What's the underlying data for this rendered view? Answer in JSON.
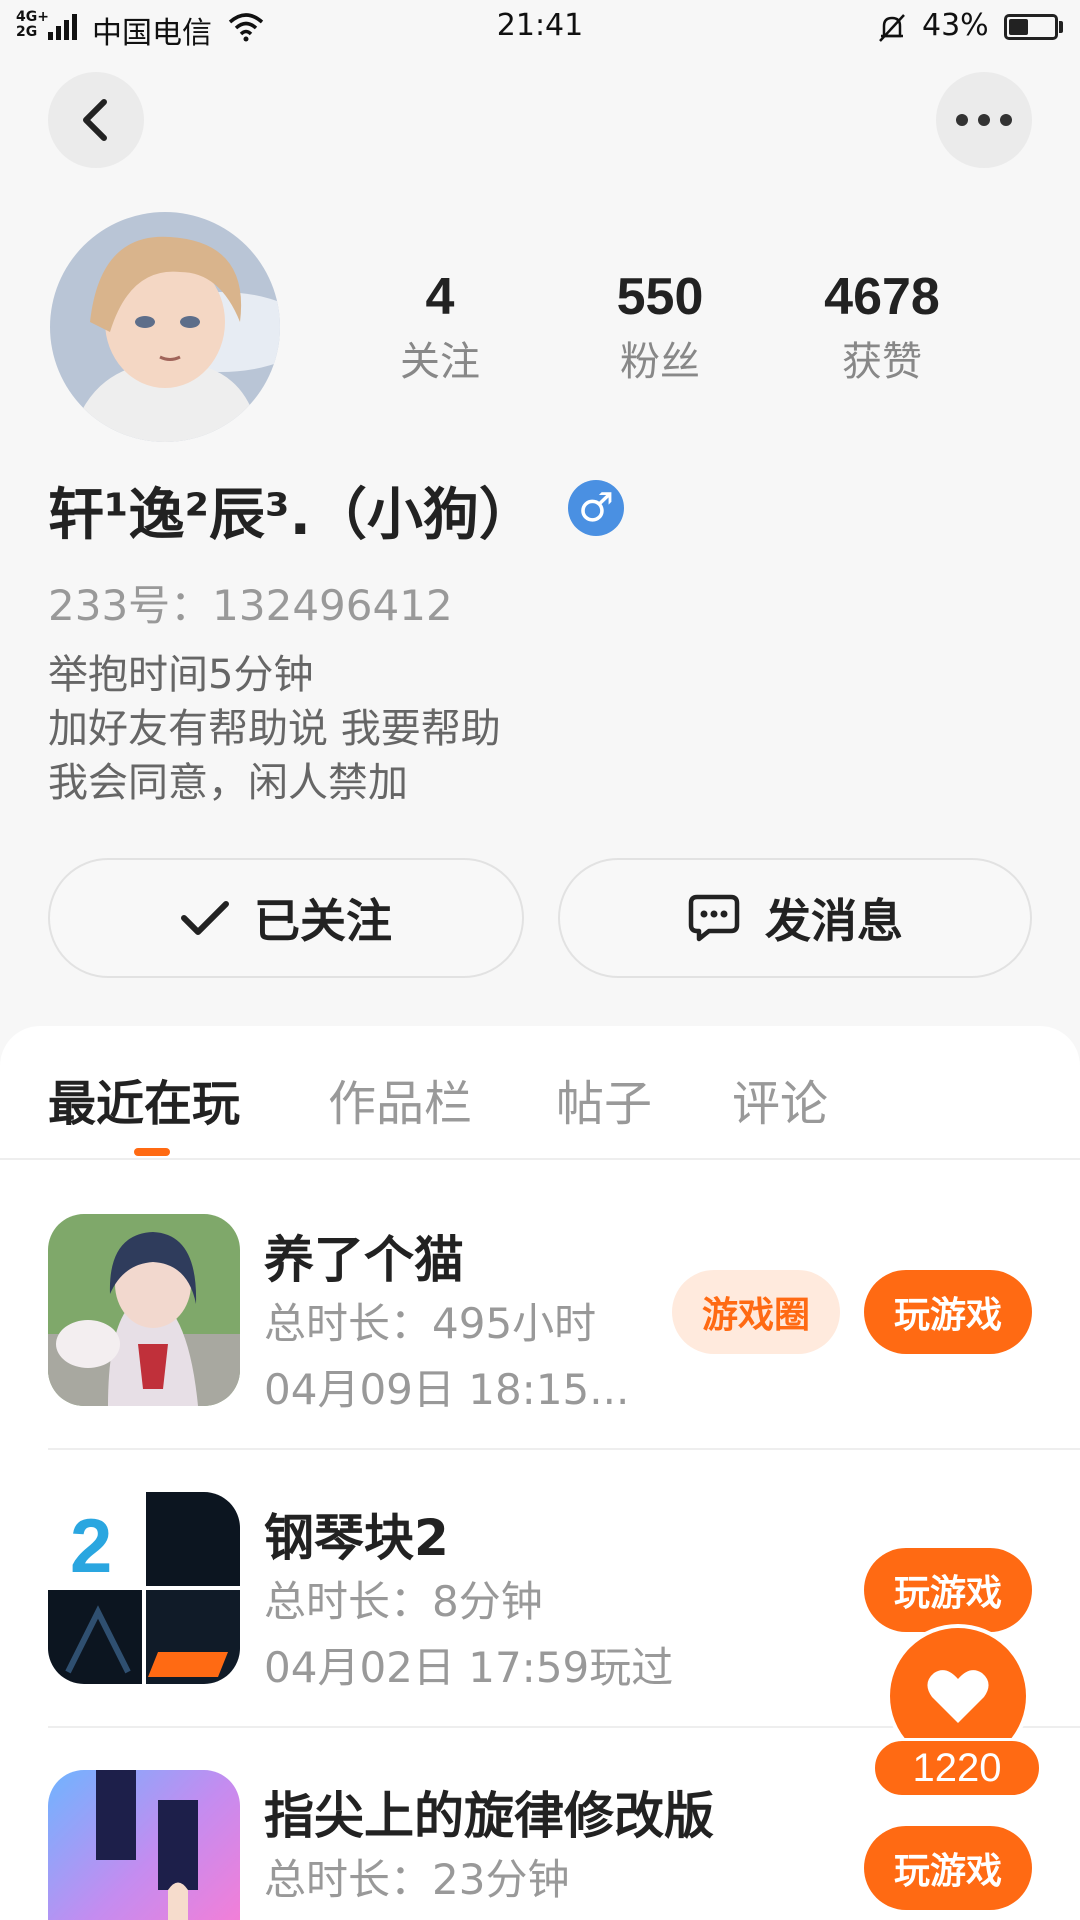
{
  "status_bar": {
    "network": "4G+\n2G",
    "carrier": "中国电信",
    "time": "21:41",
    "battery_percent": "43%",
    "battery_level": 0.43
  },
  "profile": {
    "following_count": "4",
    "following_label": "关注",
    "followers_count": "550",
    "followers_label": "粉丝",
    "likes_count": "4678",
    "likes_label": "获赞",
    "nickname": "轩¹逸²辰³.（小狗）",
    "gender_symbol": "♂",
    "uid": "233号：132496412",
    "bio_lines": [
      "举抱时间5分钟",
      "加好友有帮助说 我要帮助",
      "我会同意，闲人禁加"
    ],
    "follow_button": "已关注",
    "message_button": "发消息"
  },
  "tabs": [
    "最近在玩",
    "作品栏",
    "帖子",
    "评论"
  ],
  "games": [
    {
      "name": "养了个猫",
      "duration": "总时长：495小时",
      "last_played": "04月09日 18:15...",
      "circle_label": "游戏圈",
      "play_label": "玩游戏"
    },
    {
      "name": "钢琴块2",
      "duration": "总时长：8分钟",
      "last_played": "04月02日 17:59玩过",
      "play_label": "玩游戏"
    },
    {
      "name": "指尖上的旋律修改版",
      "duration": "总时长：23分钟",
      "play_label": "玩游戏"
    }
  ],
  "like_fab": {
    "count": "1220"
  },
  "colors": {
    "accent": "#ff6a13",
    "gender_badge": "#4a90e2"
  }
}
